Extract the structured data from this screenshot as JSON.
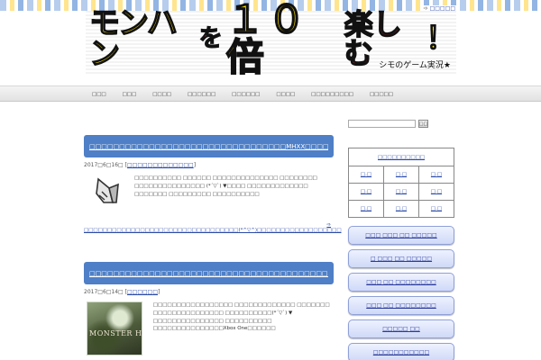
{
  "header": {
    "sitemap_label": "□□□□□",
    "banner": {
      "title_part1": "モンハン",
      "title_part2": "を",
      "title_part3": "１０倍",
      "title_part4": "楽しむ",
      "title_part5": "！",
      "subtitle": "シモのゲーム実況★"
    }
  },
  "nav": {
    "items": [
      "□□□",
      "□□□",
      "□□□□",
      "□□□□□□",
      "□□□□□□",
      "□□□□",
      "□□□□□□□□□",
      "□□□□□"
    ]
  },
  "posts": [
    {
      "title": "□□□□□□□□□□□□□□□□□□□□□□□□□□□□□□□□□MHXX□□□□□□□",
      "date": "2017□6□16□",
      "category": "□□□□□□□□□□□□□",
      "excerpt": "□□□□□□□□□□ □□□□□□ □□□□□□□□□□□□□□ □□□□□□□□ □□□□□□□□□□□□□□□ (*´▽`) ▼□□□□ □□□□□□□□□□□□□ □□□□□□□ □□□□□□□□□ □□□□□□□□□□",
      "more_link": "□□□□□□□□□□□□□□□□□□□□□□□□□□□□□□□□□(*^▽^)□□□□□□□□□□□□□□□□□□"
    },
    {
      "title": "□□□□□□□□□□□□□□□□□□□□□□□□□□□□□□□□□□□□□□□□Xbox One□",
      "date": "2017□6□14□",
      "category": "□□□□□□",
      "excerpt": "□□□□□□□□□□□□□□□□□ □□□□□□□□□□□□□ □□□□□□□ □□□□□□□□□□□□□□□ □□□□□□□□□□(*´▽`) ▼ □□□□□□□□□□□□□□□ □□□□□□□□□□ □□□□□□□□□□□□□□□Xbox One□□□□□□",
      "thumb_logo": "MONSTER HUN"
    }
  ],
  "sidebar": {
    "search_button": "□□",
    "table_header": "□□□□□□□□□□",
    "table_rows": [
      [
        "□.□",
        "□.□",
        "□.□"
      ],
      [
        "□.□",
        "□.□",
        "□.□"
      ],
      [
        "□.□",
        "□.□",
        "□.□"
      ]
    ],
    "buttons": [
      "□□□ □□□ □□ □□□□□",
      "□ □□□ □□ □□□□□",
      "□□□ □□ □□□□□□□□",
      "□□□ □□ □□□□□□□□",
      "□□□□□ □□",
      "□□□□□□□□□□□"
    ]
  },
  "colors": {
    "title_bar": "#4f7fc6",
    "link": "#2a4aa8",
    "side_button": "#cfd9f7"
  }
}
